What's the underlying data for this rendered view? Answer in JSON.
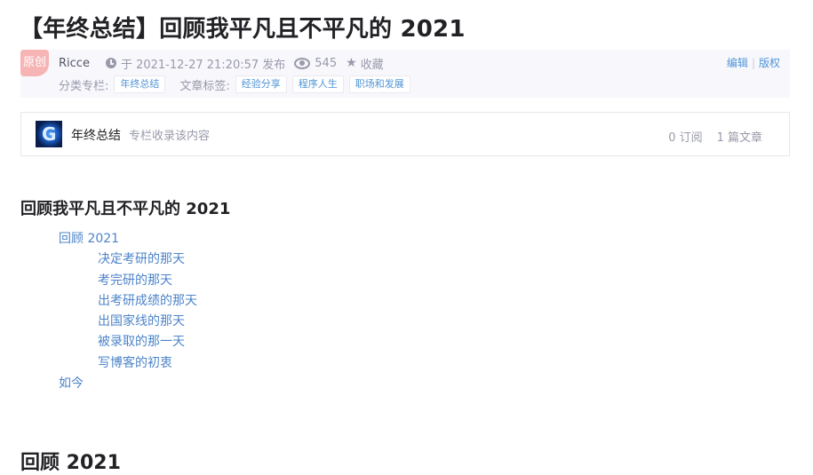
{
  "article": {
    "title": "【年终总结】回顾我平凡且不平凡的 2021"
  },
  "meta": {
    "badge": "原创",
    "author": "Ricce",
    "date": "于 2021-12-27 21:20:57 发布",
    "views": "545",
    "favorite": "收藏",
    "edit": "编辑",
    "copyright": "版权",
    "category_label": "分类专栏:",
    "categories": [
      "年终总结"
    ],
    "tag_label": "文章标签:",
    "tags": [
      "经验分享",
      "程序人生",
      "职场和发展"
    ]
  },
  "column": {
    "name": "年终总结",
    "desc": "专栏收录该内容",
    "subs": "0 订阅",
    "articles": "1 篇文章"
  },
  "toc": {
    "title": "回顾我平凡且不平凡的 2021",
    "items": [
      "回顾 2021",
      "决定考研的那天",
      "考完研的那天",
      "出考研成绩的那天",
      "出国家线的那天",
      "被录取的那一天",
      "写博客的初衷",
      "如今"
    ]
  },
  "section": {
    "heading": "回顾 2021"
  }
}
